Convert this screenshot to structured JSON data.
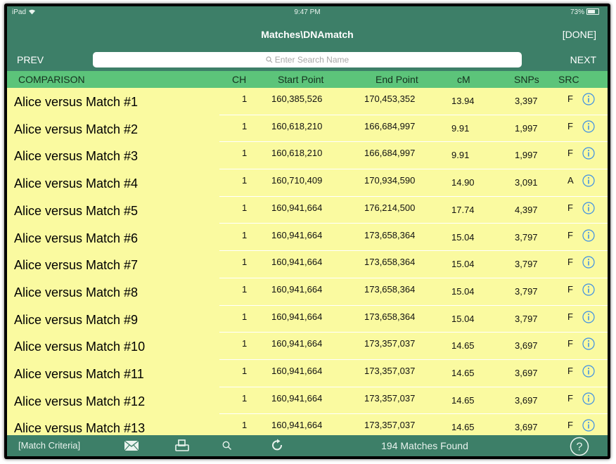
{
  "status": {
    "device": "iPad",
    "time": "9:47 PM",
    "battery": "73%"
  },
  "nav": {
    "title": "Matches\\DNAmatch",
    "done": "[DONE]"
  },
  "search": {
    "prev": "PREV",
    "next": "NEXT",
    "placeholder": "Enter Search Name"
  },
  "columns": {
    "comparison": "COMPARISON",
    "ch": "CH",
    "start": "Start Point",
    "end": "End Point",
    "cm": "cM",
    "snps": "SNPs",
    "src": "SRC"
  },
  "rows": [
    {
      "name": "Alice versus Match #1",
      "ch": "1",
      "start": "160,385,526",
      "end": "170,453,352",
      "cm": "13.94",
      "snps": "3,397",
      "src": "F"
    },
    {
      "name": "Alice versus Match #2",
      "ch": "1",
      "start": "160,618,210",
      "end": "166,684,997",
      "cm": "9.91",
      "snps": "1,997",
      "src": "F"
    },
    {
      "name": "Alice versus Match #3",
      "ch": "1",
      "start": "160,618,210",
      "end": "166,684,997",
      "cm": "9.91",
      "snps": "1,997",
      "src": "F"
    },
    {
      "name": "Alice versus Match #4",
      "ch": "1",
      "start": "160,710,409",
      "end": "170,934,590",
      "cm": "14.90",
      "snps": "3,091",
      "src": "A"
    },
    {
      "name": "Alice versus Match #5",
      "ch": "1",
      "start": "160,941,664",
      "end": "176,214,500",
      "cm": "17.74",
      "snps": "4,397",
      "src": "F"
    },
    {
      "name": "Alice versus Match #6",
      "ch": "1",
      "start": "160,941,664",
      "end": "173,658,364",
      "cm": "15.04",
      "snps": "3,797",
      "src": "F"
    },
    {
      "name": "Alice versus Match #7",
      "ch": "1",
      "start": "160,941,664",
      "end": "173,658,364",
      "cm": "15.04",
      "snps": "3,797",
      "src": "F"
    },
    {
      "name": "Alice versus Match #8",
      "ch": "1",
      "start": "160,941,664",
      "end": "173,658,364",
      "cm": "15.04",
      "snps": "3,797",
      "src": "F"
    },
    {
      "name": "Alice versus Match #9",
      "ch": "1",
      "start": "160,941,664",
      "end": "173,658,364",
      "cm": "15.04",
      "snps": "3,797",
      "src": "F"
    },
    {
      "name": "Alice versus Match #10",
      "ch": "1",
      "start": "160,941,664",
      "end": "173,357,037",
      "cm": "14.65",
      "snps": "3,697",
      "src": "F"
    },
    {
      "name": "Alice versus Match #11",
      "ch": "1",
      "start": "160,941,664",
      "end": "173,357,037",
      "cm": "14.65",
      "snps": "3,697",
      "src": "F"
    },
    {
      "name": "Alice versus Match #12",
      "ch": "1",
      "start": "160,941,664",
      "end": "173,357,037",
      "cm": "14.65",
      "snps": "3,697",
      "src": "F"
    },
    {
      "name": "Alice versus Match #13",
      "ch": "1",
      "start": "160,941,664",
      "end": "173,357,037",
      "cm": "14.65",
      "snps": "3,697",
      "src": "F"
    }
  ],
  "toolbar": {
    "criteria": "[Match Criteria]",
    "found": "194 Matches Found"
  },
  "icons": {
    "search": "search-icon",
    "mail": "mail-icon",
    "print": "print-icon",
    "refresh": "refresh-icon",
    "help": "help-icon",
    "info": "info-icon"
  },
  "colors": {
    "bar": "#3d7f68",
    "header": "#5cc47a",
    "rows": "#fafaa0",
    "info": "#3a8ee6"
  }
}
